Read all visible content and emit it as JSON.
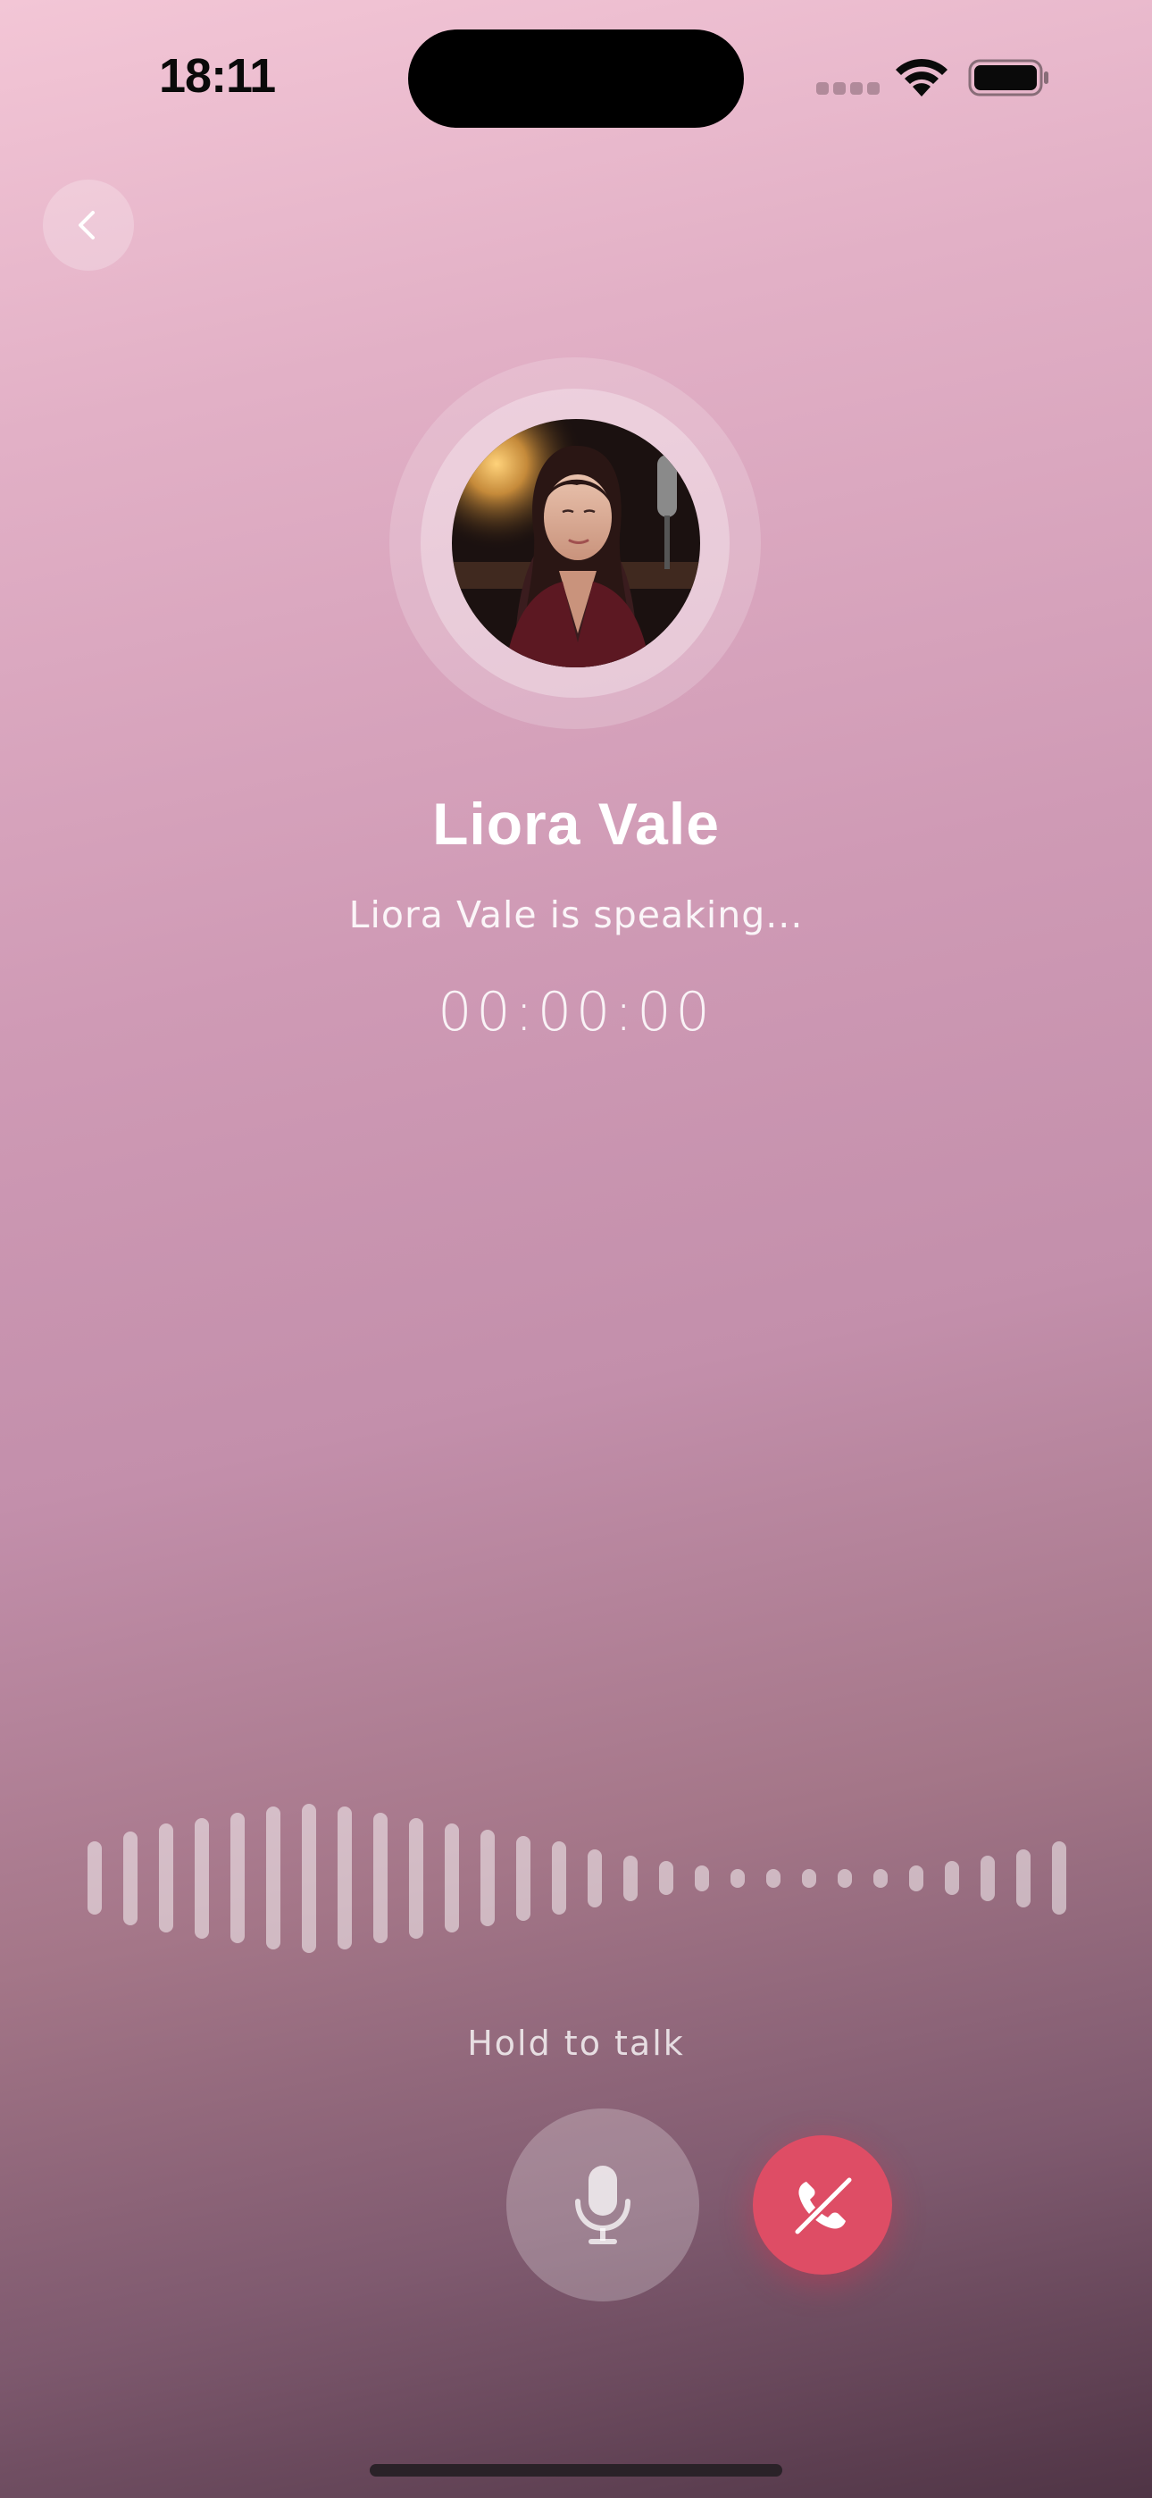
{
  "status_bar": {
    "time": "18:11",
    "signal_icon": "cellular-signal-icon",
    "wifi_icon": "wifi-icon",
    "battery_icon": "battery-icon",
    "battery_level": 1.0
  },
  "nav": {
    "back_icon": "chevron-left-icon"
  },
  "call": {
    "contact_name": "Liora Vale",
    "status_text": "Liora Vale is speaking...",
    "timer": "00:00:00",
    "waveform_levels": [
      0.43,
      0.55,
      0.64,
      0.71,
      0.77,
      0.84,
      0.88,
      0.84,
      0.77,
      0.71,
      0.64,
      0.57,
      0.5,
      0.43,
      0.34,
      0.27,
      0.2,
      0.15,
      0.11,
      0.11,
      0.11,
      0.11,
      0.11,
      0.15,
      0.2,
      0.27,
      0.34,
      0.43
    ]
  },
  "controls": {
    "hold_label": "Hold to talk",
    "mic_icon": "microphone-icon",
    "end_call_icon": "phone-off-icon"
  },
  "colors": {
    "end_call": "#de4d65",
    "text": "#ffffff"
  }
}
